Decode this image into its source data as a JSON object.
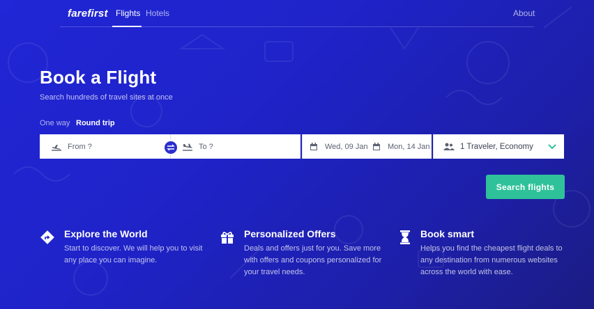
{
  "nav": {
    "logo": "farefirst",
    "links": [
      "Flights",
      "Hotels"
    ],
    "about": "About"
  },
  "hero": {
    "title": "Book a Flight",
    "subtitle": "Search hundreds of travel sites at once"
  },
  "trip_type": {
    "one_way": "One way",
    "round_trip": "Round trip",
    "selected": "Round trip"
  },
  "search": {
    "from_placeholder": "From ?",
    "to_placeholder": "To ?",
    "depart_date": "Wed, 09 Jan",
    "return_date": "Mon, 14 Jan",
    "travelers": "1 Traveler, Economy",
    "button": "Search flights"
  },
  "features": [
    {
      "title": "Explore the World",
      "text": "Start to discover. We will help you to visit any place you can imagine.",
      "icon": "directions-icon"
    },
    {
      "title": "Personalized Offers",
      "text": "Deals and offers just for you. Save more with offers and coupons personalized for your travel needs.",
      "icon": "gift-icon"
    },
    {
      "title": "Book smart",
      "text": "Helps you find the cheapest flight deals to any destination from numerous websites across the world with ease.",
      "icon": "hourglass-icon"
    }
  ],
  "colors": {
    "background": "#2126d6",
    "accent_button": "#2fc19a",
    "chevron": "#2fc19a"
  }
}
